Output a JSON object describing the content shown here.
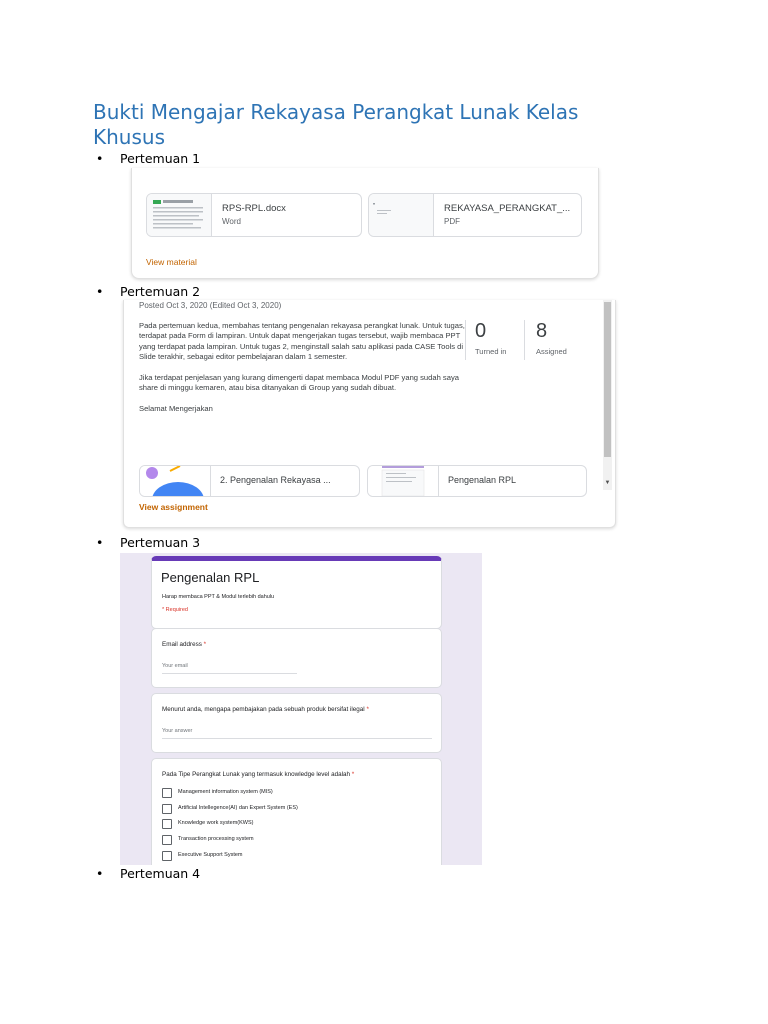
{
  "document": {
    "title": "Bukti Mengajar Rekayasa Perangkat Lunak Kelas Khusus",
    "bullet_char": "•",
    "bullets": [
      "Pertemuan 1",
      "Pertemuan 2",
      "Pertemuan 3",
      "Pertemuan 4"
    ]
  },
  "shot1": {
    "attachments": [
      {
        "name": "RPS-RPL.docx",
        "type": "Word"
      },
      {
        "name": "REKAYASA_PERANGKAT_...",
        "type": "PDF"
      }
    ],
    "link": "View material",
    "link_color": "#c26401"
  },
  "shot2": {
    "posted": "Posted Oct 3, 2020 (Edited Oct 3, 2020)",
    "paragraphs": [
      "Pada pertemuan kedua, membahas tentang pengenalan rekayasa perangkat lunak. Untuk tugas, terdapat pada Form di lampiran. Untuk dapat mengerjakan tugas tersebut, wajib membaca PPT yang terdapat pada lampiran. Untuk tugas 2, menginstall salah satu aplikasi pada CASE Tools di Slide terakhir, sebagai editor pembelajaran dalam 1 semester.",
      "Jika terdapat penjelasan yang kurang dimengerti dapat membaca Modul PDF yang sudah saya share di minggu kemaren, atau bisa ditanyakan di Group yang sudah dibuat.",
      "Selamat Mengerjakan"
    ],
    "stats": [
      {
        "value": "0",
        "label": "Turned in"
      },
      {
        "value": "8",
        "label": "Assigned"
      }
    ],
    "attachments": [
      {
        "name": "2. Pengenalan Rekayasa ...",
        "icon": "slides-thumbnail"
      },
      {
        "name": "Pengenalan RPL",
        "icon": "form-thumbnail"
      }
    ],
    "link": "View assignment",
    "scroll_down_icon": "▼"
  },
  "shot3": {
    "accent": "#673ab7",
    "background": "#ebe7f3",
    "form_title": "Pengenalan RPL",
    "form_desc": "Harap membaca PPT & Modul terlebih dahulu",
    "required_note": "* Required",
    "questions": [
      {
        "label": "Email address",
        "star": "*",
        "placeholder": "Your email"
      },
      {
        "label": "Menurut anda, mengapa pembajakan pada sebuah produk bersifat ilegal",
        "star": "*",
        "placeholder": "Your answer"
      },
      {
        "label": "Pada Tipe Perangkat Lunak yang termasuk knowledge level adalah",
        "star": "*"
      }
    ],
    "options": [
      "Management information system (MIS)",
      "Artificial Intellegence(AI) dan Expert System (ES)",
      "Knowledge work system(KWS)",
      "Transaction processing system",
      "Executive Support System"
    ]
  }
}
